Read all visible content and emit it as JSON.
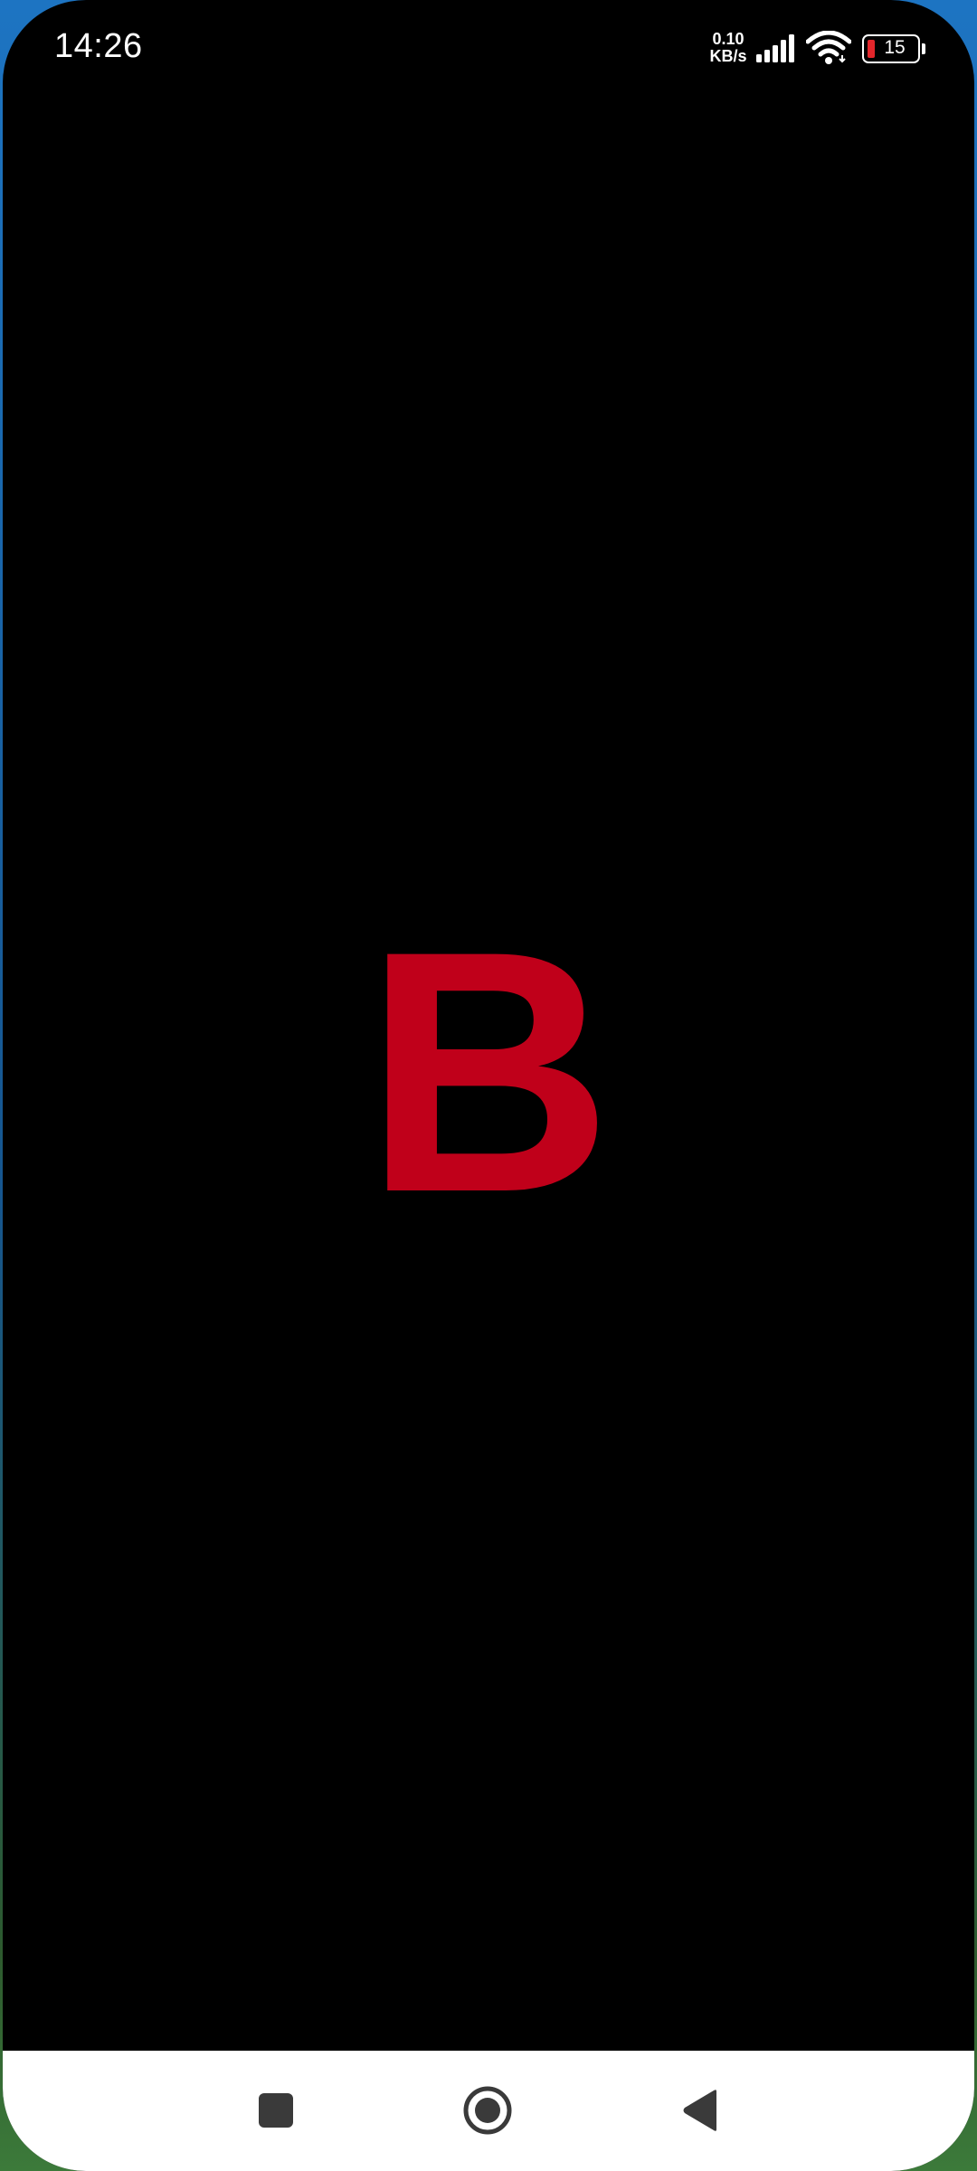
{
  "status_bar": {
    "time": "14:26",
    "net_speed_value": "0.10",
    "net_speed_unit": "KB/s",
    "signal_icon": "cellular-signal-icon",
    "wifi_icon": "wifi-icon",
    "battery_level": "15",
    "battery_icon": "battery-low-icon"
  },
  "splash": {
    "logo_letter": "B"
  },
  "navigation": {
    "recents_icon": "square-recents-icon",
    "home_icon": "circle-home-icon",
    "back_icon": "triangle-back-icon"
  },
  "colors": {
    "screen_background": "#000000",
    "logo_red": "#c0001a",
    "nav_bar_background": "#ffffff",
    "nav_icon": "#3a3a3a",
    "battery_low_red": "#e3262b"
  }
}
